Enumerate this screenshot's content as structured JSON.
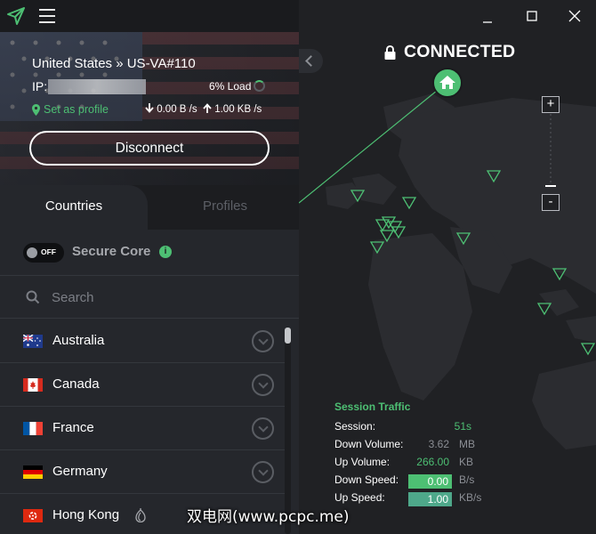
{
  "app": {
    "logo_icon": "protonvpn-triangle-logo",
    "menu_icon": "hamburger-menu-icon"
  },
  "connection": {
    "server": "United States » US-VA#110",
    "ip_label": "IP:",
    "load": "6% Load",
    "set_profile": "Set as profile",
    "down_rate": "0.00 B /s",
    "up_rate": "1.00 KB /s",
    "disconnect_label": "Disconnect",
    "status": "CONNECTED"
  },
  "tabs": {
    "countries": "Countries",
    "profiles": "Profiles",
    "active": "countries"
  },
  "secure_core": {
    "toggle_label": "OFF",
    "label": "Secure Core",
    "state": "off"
  },
  "search": {
    "placeholder": "Search",
    "value": ""
  },
  "countries": [
    {
      "name": "Australia"
    },
    {
      "name": "Canada"
    },
    {
      "name": "France"
    },
    {
      "name": "Germany"
    },
    {
      "name": "Hong Kong",
      "badge_icon": "tor-onion-icon"
    }
  ],
  "zoom": {
    "in": "+",
    "out": "-"
  },
  "traffic": {
    "title": "Session Traffic",
    "rows": [
      {
        "label": "Session:",
        "value": "51s",
        "unit": ""
      },
      {
        "label": "Down Volume:",
        "value": "3.62",
        "unit": "MB"
      },
      {
        "label": "Up Volume:",
        "value": "266.00",
        "unit": "KB"
      },
      {
        "label": "Down Speed:",
        "value": "0.00",
        "unit": "B/s"
      },
      {
        "label": "Up Speed:",
        "value": "1.00",
        "unit": "KB/s"
      }
    ]
  },
  "watermark": "双电网(www.pcpc.me)",
  "colors": {
    "accent": "#4dbf73",
    "background": "#1f2023",
    "panel": "#25272c"
  }
}
